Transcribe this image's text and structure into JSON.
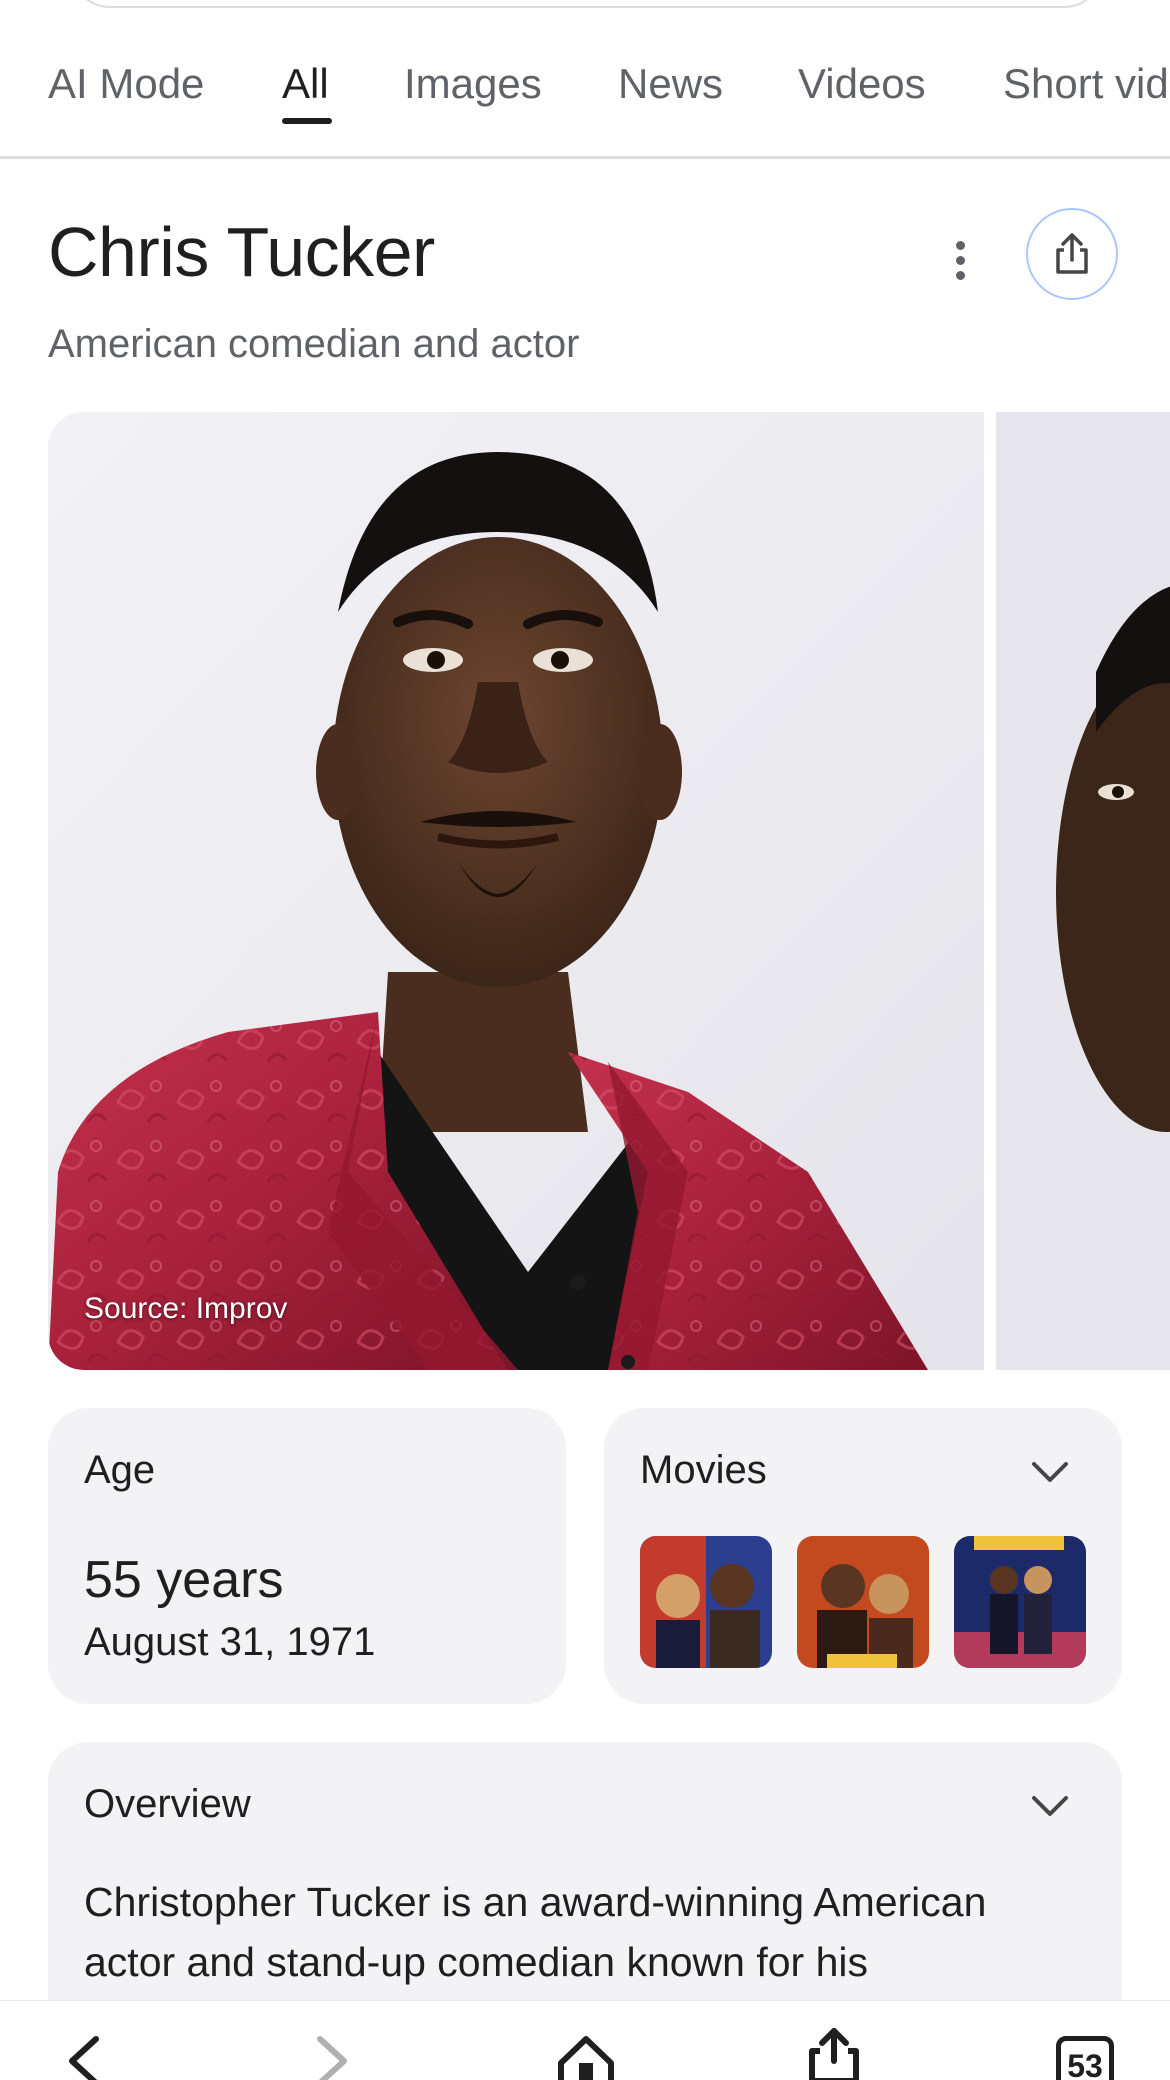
{
  "tabs": [
    {
      "label": "AI Mode"
    },
    {
      "label": "All"
    },
    {
      "label": "Images"
    },
    {
      "label": "News"
    },
    {
      "label": "Videos"
    },
    {
      "label": "Short vid"
    }
  ],
  "active_tab": "All",
  "entity": {
    "name": "Chris Tucker",
    "description": "American comedian and actor"
  },
  "hero": {
    "source": "Source: Improv"
  },
  "age_card": {
    "title": "Age",
    "value": "55 years",
    "date": "August 31, 1971"
  },
  "movies_card": {
    "title": "Movies"
  },
  "overview": {
    "title": "Overview",
    "text": "Christopher Tucker is an award-winning American actor and stand-up comedian known for his"
  },
  "browser": {
    "tab_count": "53"
  },
  "colors": {
    "accent_blue": "#a8c7fa",
    "card_bg": "#f3f3f6",
    "muted_text": "#5f6368"
  },
  "icons": {
    "more": "more-vert-icon",
    "share": "share-icon",
    "chevron": "chevron-down-icon",
    "back": "back-icon",
    "forward": "forward-icon",
    "home": "home-icon",
    "share_browser": "share-icon",
    "tabs": "tabs-icon"
  }
}
